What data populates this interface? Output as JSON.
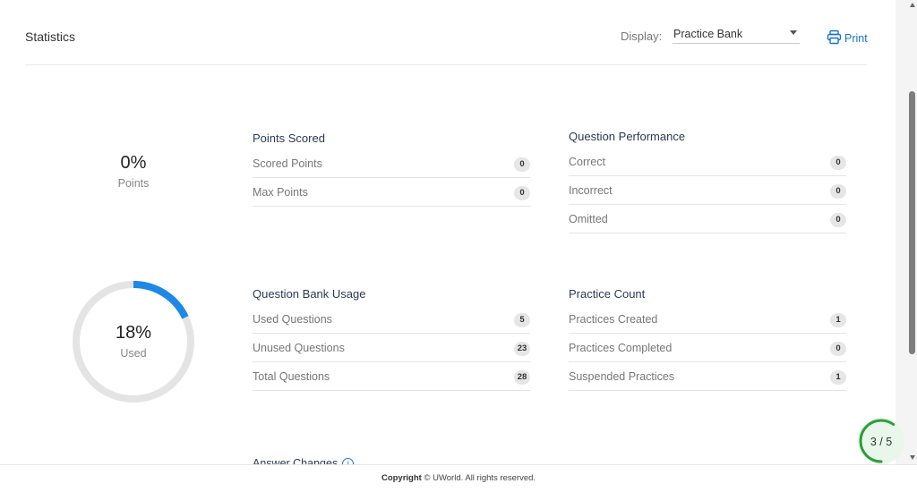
{
  "header": {
    "title": "Statistics",
    "display_label": "Display:",
    "display_value": "Practice Bank",
    "print_label": "Print"
  },
  "points_summary": {
    "percent": "0%",
    "label": "Points"
  },
  "usage_summary": {
    "percent": "18%",
    "label": "Used",
    "fraction": 0.18
  },
  "points_scored": {
    "title": "Points Scored",
    "rows": [
      {
        "label": "Scored Points",
        "value": "0"
      },
      {
        "label": "Max Points",
        "value": "0"
      }
    ]
  },
  "question_performance": {
    "title": "Question Performance",
    "rows": [
      {
        "label": "Correct",
        "value": "0"
      },
      {
        "label": "Incorrect",
        "value": "0"
      },
      {
        "label": "Omitted",
        "value": "0"
      }
    ]
  },
  "question_bank_usage": {
    "title": "Question Bank Usage",
    "rows": [
      {
        "label": "Used Questions",
        "value": "5"
      },
      {
        "label": "Unused Questions",
        "value": "23"
      },
      {
        "label": "Total Questions",
        "value": "28"
      }
    ]
  },
  "practice_count": {
    "title": "Practice Count",
    "rows": [
      {
        "label": "Practices Created",
        "value": "1"
      },
      {
        "label": "Practices Completed",
        "value": "0"
      },
      {
        "label": "Suspended Practices",
        "value": "1"
      }
    ]
  },
  "answer_changes": {
    "title": "Answer Changes",
    "info_icon": "i"
  },
  "footer": {
    "copyright_bold": "Copyright",
    "copyright_rest": " © UWorld. All rights reserved."
  },
  "progress_widget": {
    "text": "3 / 5",
    "fraction": 0.6
  },
  "colors": {
    "accent": "#1a73c9",
    "donut_fill": "#1e88e5",
    "donut_track": "#e4e4e4",
    "progress_ring": "#2e9d3a"
  }
}
